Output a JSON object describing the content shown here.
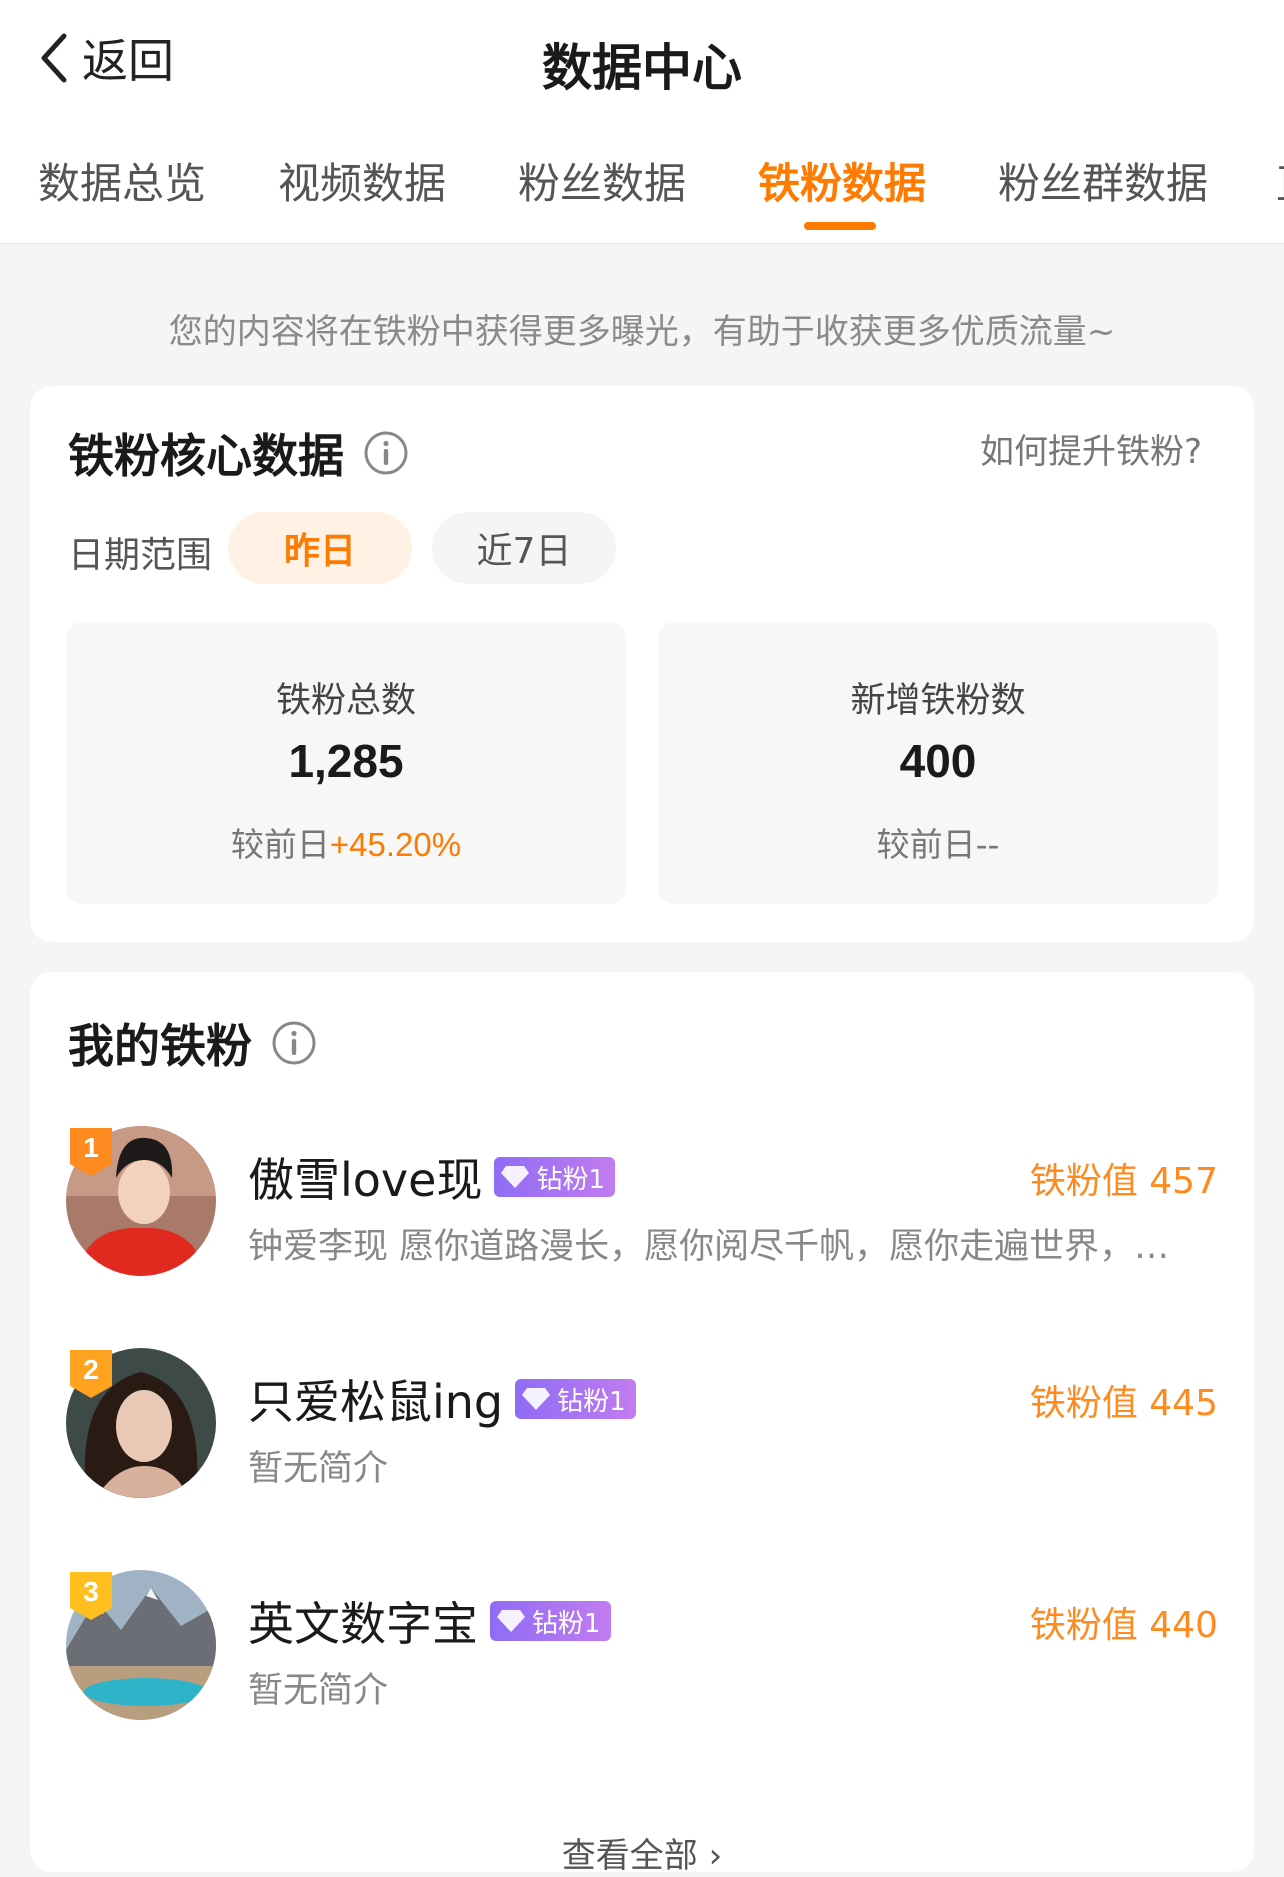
{
  "header": {
    "back_label": "返回",
    "title": "数据中心"
  },
  "tabs": [
    {
      "label": "数据总览",
      "active": false
    },
    {
      "label": "视频数据",
      "active": false
    },
    {
      "label": "粉丝数据",
      "active": false
    },
    {
      "label": "铁粉数据",
      "active": true
    },
    {
      "label": "粉丝群数据",
      "active": false
    },
    {
      "label": "直",
      "active": false
    }
  ],
  "hint": "您的内容将在铁粉中获得更多曝光，有助于收获更多优质流量~",
  "core": {
    "title": "铁粉核心数据",
    "help_link": "如何提升铁粉?",
    "range_label": "日期范围",
    "ranges": [
      "昨日",
      "近7日"
    ],
    "selected_range": "昨日",
    "stats": [
      {
        "name": "铁粉总数",
        "value": "1,285",
        "compare_prefix": "较前日",
        "compare_value": "+45.20%"
      },
      {
        "name": "新增铁粉数",
        "value": "400",
        "compare_prefix": "较前日",
        "compare_value": "--"
      }
    ]
  },
  "fans": {
    "title": "我的铁粉",
    "list": [
      {
        "rank": "1",
        "name": "傲雪love现",
        "badge": "钻粉1",
        "score": "铁粉值 457",
        "bio": "钟爱李现 愿你道路漫长，愿你阅尽千帆，愿你走遍世界，…"
      },
      {
        "rank": "2",
        "name": "只爱松鼠ing",
        "badge": "钻粉1",
        "score": "铁粉值 445",
        "bio": "暂无简介"
      },
      {
        "rank": "3",
        "name": "英文数字宝",
        "badge": "钻粉1",
        "score": "铁粉值 440",
        "bio": "暂无简介"
      }
    ],
    "more_label": "查看全部"
  },
  "colors": {
    "accent": "#ff7a00",
    "badge": "#9b6cf5"
  },
  "icons": [
    "chevron-left-icon",
    "info-icon",
    "diamond-icon",
    "rank-badge-icon"
  ]
}
